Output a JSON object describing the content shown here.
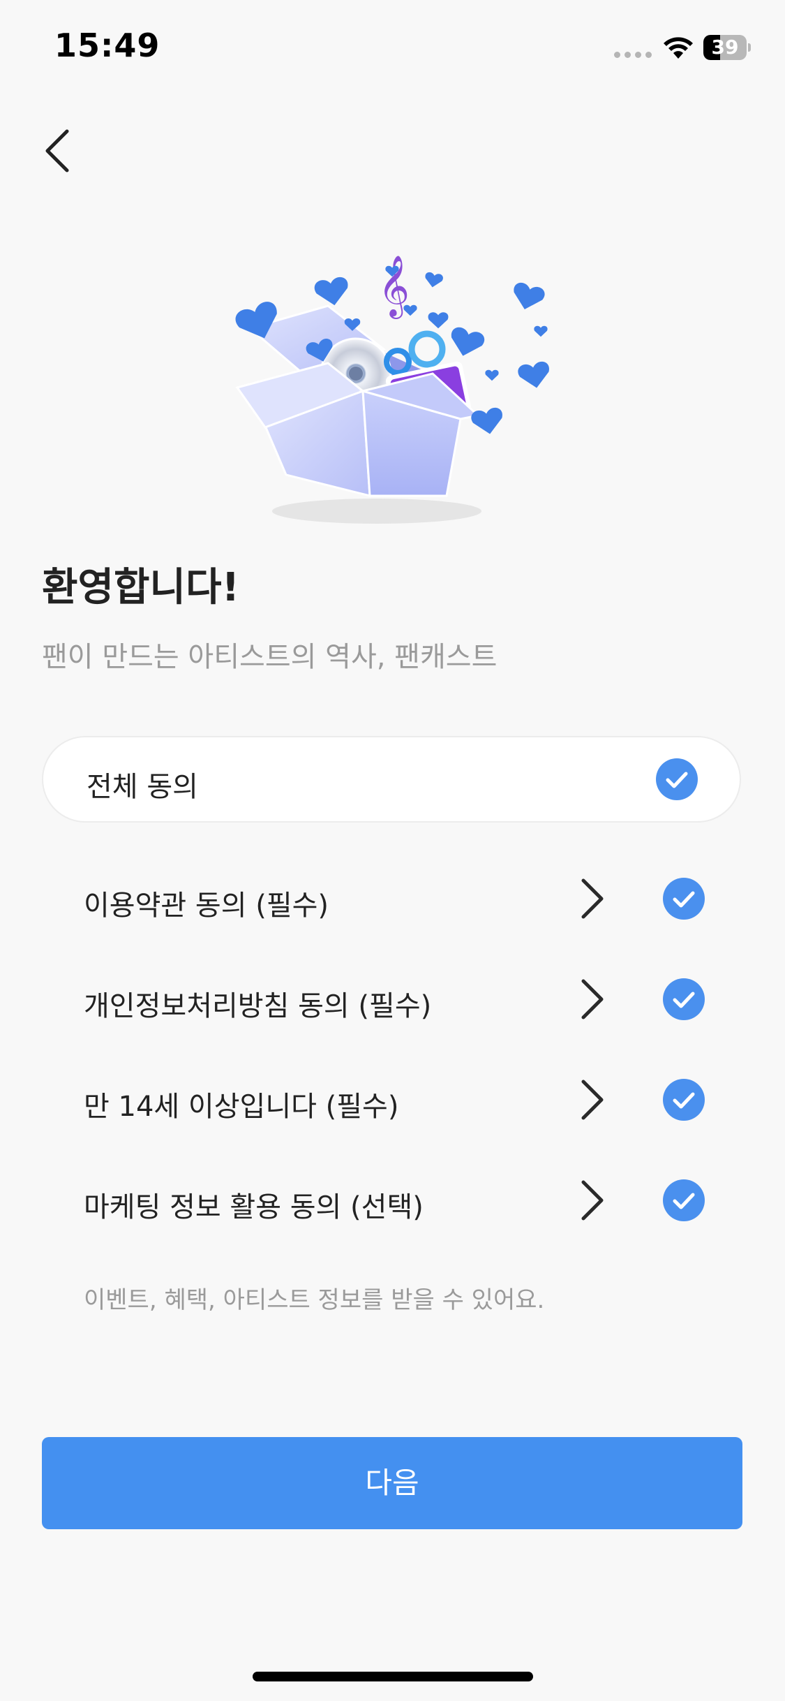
{
  "status_bar": {
    "time": "15:49",
    "battery_percent": "39",
    "battery_level": 0.39
  },
  "header": {
    "back_icon": "chevron-left-icon"
  },
  "hero": {
    "icon": "gift-box-illustration"
  },
  "welcome": {
    "title": "환영합니다!",
    "subtitle": "팬이 만드는 아티스트의 역사, 팬캐스트"
  },
  "agree_all": {
    "label": "전체 동의",
    "checked": true
  },
  "terms": [
    {
      "label": "이용약관 동의 (필수)",
      "checked": true
    },
    {
      "label": "개인정보처리방침 동의 (필수)",
      "checked": true
    },
    {
      "label": "만 14세 이상입니다 (필수)",
      "checked": true
    },
    {
      "label": "마케팅 정보 활용 동의 (선택)",
      "checked": true
    }
  ],
  "marketing_note": "이벤트, 혜택, 아티스트 정보를 받을 수 있어요.",
  "next_button": {
    "label": "다음"
  },
  "colors": {
    "accent": "#4490f0",
    "check": "#4a90ee",
    "background": "#f8f8f8",
    "muted_text": "#9a9a9a"
  }
}
